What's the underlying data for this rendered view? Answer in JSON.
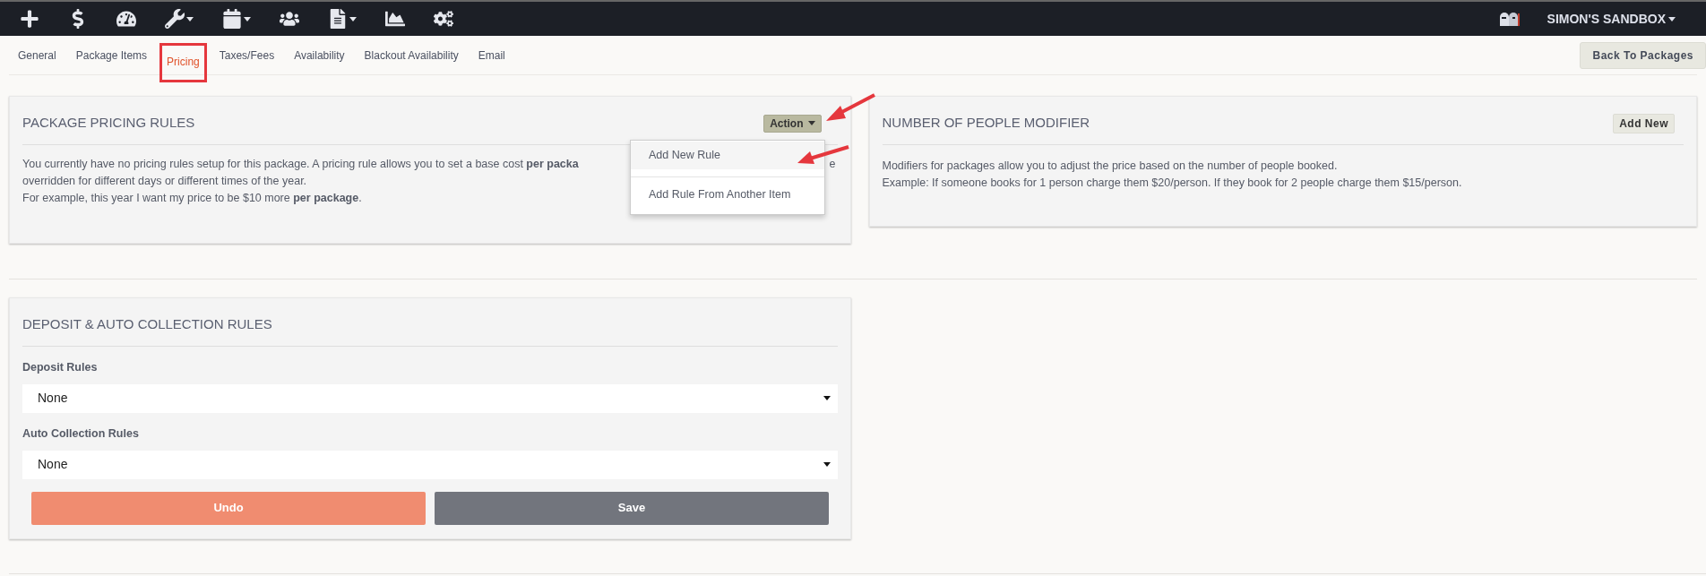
{
  "top_bar": {
    "nav_icons": [
      {
        "kind": "plus",
        "has_menu": false
      },
      {
        "kind": "dollar",
        "has_menu": false
      },
      {
        "kind": "gauge",
        "has_menu": false
      },
      {
        "kind": "wrench",
        "has_menu": true
      },
      {
        "kind": "calendar",
        "has_menu": true
      },
      {
        "kind": "users",
        "has_menu": false
      },
      {
        "kind": "file",
        "has_menu": true
      },
      {
        "kind": "chart",
        "has_menu": false
      },
      {
        "kind": "cogs",
        "has_menu": false
      }
    ],
    "account": "SIMON'S SANDBOX"
  },
  "tabs": [
    {
      "label": "General",
      "selected": false
    },
    {
      "label": "Package Items",
      "selected": false
    },
    {
      "label": "Pricing",
      "selected": true
    },
    {
      "label": "Taxes/Fees",
      "selected": false
    },
    {
      "label": "Availability",
      "selected": false
    },
    {
      "label": "Blackout Availability",
      "selected": false
    },
    {
      "label": "Email",
      "selected": false
    }
  ],
  "back_button": "Back To Packages",
  "pricing_panel": {
    "title": "PACKAGE PRICING RULES",
    "action_button": "Action",
    "lines": [
      "You currently have no pricing rules setup for this package. A pricing rule allows you to set a base cost **per packa**",
      "overridden for different days or different times of the year.",
      "For example, this year I want my price to be $10 more **per package**."
    ],
    "line_tail": "e",
    "menu": [
      "Add New Rule",
      "Add Rule From Another Item"
    ]
  },
  "modifier_panel": {
    "title": "NUMBER OF PEOPLE MODIFIER",
    "add_button": "Add New",
    "lines": [
      "Modifiers for packages allow you to adjust the price based on the number of people booked.",
      "Example: If someone books for 1 person charge them $20/person. If they book for 2 people charge them $15/person."
    ]
  },
  "deposit_panel": {
    "title": "DEPOSIT & AUTO COLLECTION RULES",
    "fields": [
      {
        "label": "Deposit Rules",
        "value": "None"
      },
      {
        "label": "Auto Collection Rules",
        "value": "None"
      }
    ],
    "undo_button": "Undo",
    "save_button": "Save"
  }
}
